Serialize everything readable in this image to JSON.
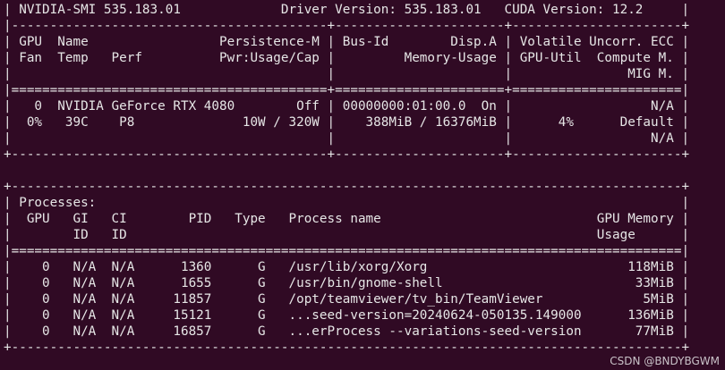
{
  "colors": {
    "background": "#300a24",
    "text": "#e6e6e6",
    "watermark": "#c9c2c8"
  },
  "terminal": {
    "lines": [
      "| NVIDIA-SMI 535.183.01             Driver Version: 535.183.01   CUDA Version: 12.2     |",
      "|-----------------------------------------+----------------------+----------------------+",
      "| GPU  Name                 Persistence-M | Bus-Id        Disp.A | Volatile Uncorr. ECC |",
      "| Fan  Temp   Perf          Pwr:Usage/Cap |         Memory-Usage | GPU-Util  Compute M. |",
      "|                                         |                      |               MIG M. |",
      "|=========================================+======================+======================|",
      "|   0  NVIDIA GeForce RTX 4080        Off | 00000000:01:00.0  On |                  N/A |",
      "|  0%   39C    P8              10W / 320W |    388MiB / 16376MiB |      4%      Default |",
      "|                                         |                      |                  N/A |",
      "+-----------------------------------------+----------------------+----------------------+",
      "",
      "+---------------------------------------------------------------------------------------+",
      "| Processes:                                                                            |",
      "|  GPU   GI   CI        PID   Type   Process name                            GPU Memory |",
      "|        ID   ID                                                             Usage      |",
      "|=======================================================================================|",
      "|    0   N/A  N/A      1360      G   /usr/lib/xorg/Xorg                          118MiB |",
      "|    0   N/A  N/A      1655      G   /usr/bin/gnome-shell                         33MiB |",
      "|    0   N/A  N/A     11857      G   /opt/teamviewer/tv_bin/TeamViewer             5MiB |",
      "|    0   N/A  N/A     15121      G   ...seed-version=20240624-050135.149000      136MiB |",
      "|    0   N/A  N/A     16857      G   ...erProcess --variations-seed-version       77MiB |",
      "+---------------------------------------------------------------------------------------+"
    ]
  },
  "watermark": "CSDN @BNDYBGWM"
}
